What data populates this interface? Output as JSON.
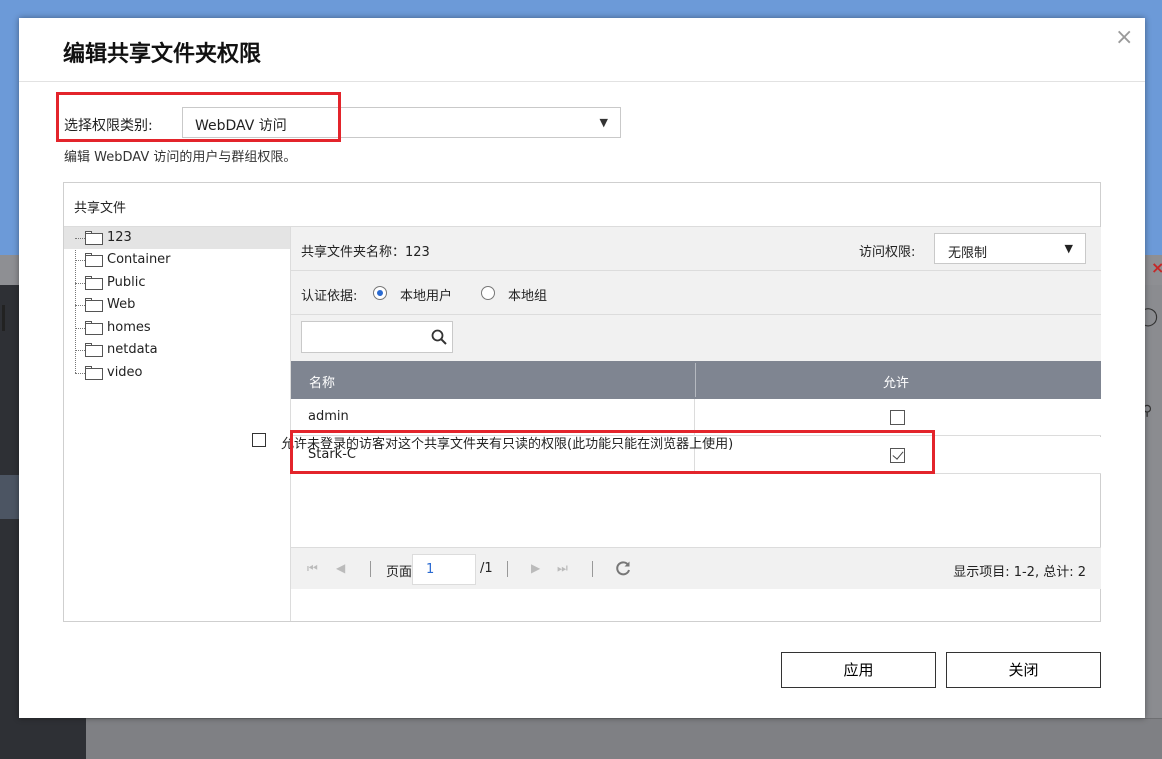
{
  "dialog": {
    "title": "编辑共享文件夹权限",
    "close_icon": "×"
  },
  "category": {
    "label": "选择权限类别:",
    "value": "WebDAV 访问",
    "description": "编辑 WebDAV 访问的用户与群组权限。"
  },
  "panel": {
    "title": "共享文件",
    "folders": [
      {
        "name": "123",
        "selected": true
      },
      {
        "name": "Container"
      },
      {
        "name": "Public"
      },
      {
        "name": "Web"
      },
      {
        "name": "homes"
      },
      {
        "name": "netdata"
      },
      {
        "name": "video"
      }
    ]
  },
  "detail": {
    "folder_name": "共享文件夹名称：123",
    "access_label": "访问权限:",
    "access_value": "无限制",
    "auth_label": "认证依据:",
    "auth_local_user": "本地用户",
    "auth_local_group": "本地组",
    "search_placeholder": ""
  },
  "table": {
    "col_name": "名称",
    "col_allow": "允许",
    "rows": [
      {
        "name": "admin",
        "allowed": false
      },
      {
        "name": "Stark-C",
        "allowed": true
      }
    ]
  },
  "pager": {
    "page_label": "页面",
    "page_value": "1",
    "page_total": "/1",
    "items_info": "显示项目:  1-2, 总计:  2"
  },
  "guest": {
    "label": "允许未登录的访客对这个共享文件夹有只读的权限(此功能只能在浏览器上使用)"
  },
  "buttons": {
    "apply": "应用",
    "close": "关闭"
  },
  "colors": {
    "highlight": "#e3242b",
    "table_header": "#7f8591",
    "radio_accent": "#2a6ad1"
  }
}
